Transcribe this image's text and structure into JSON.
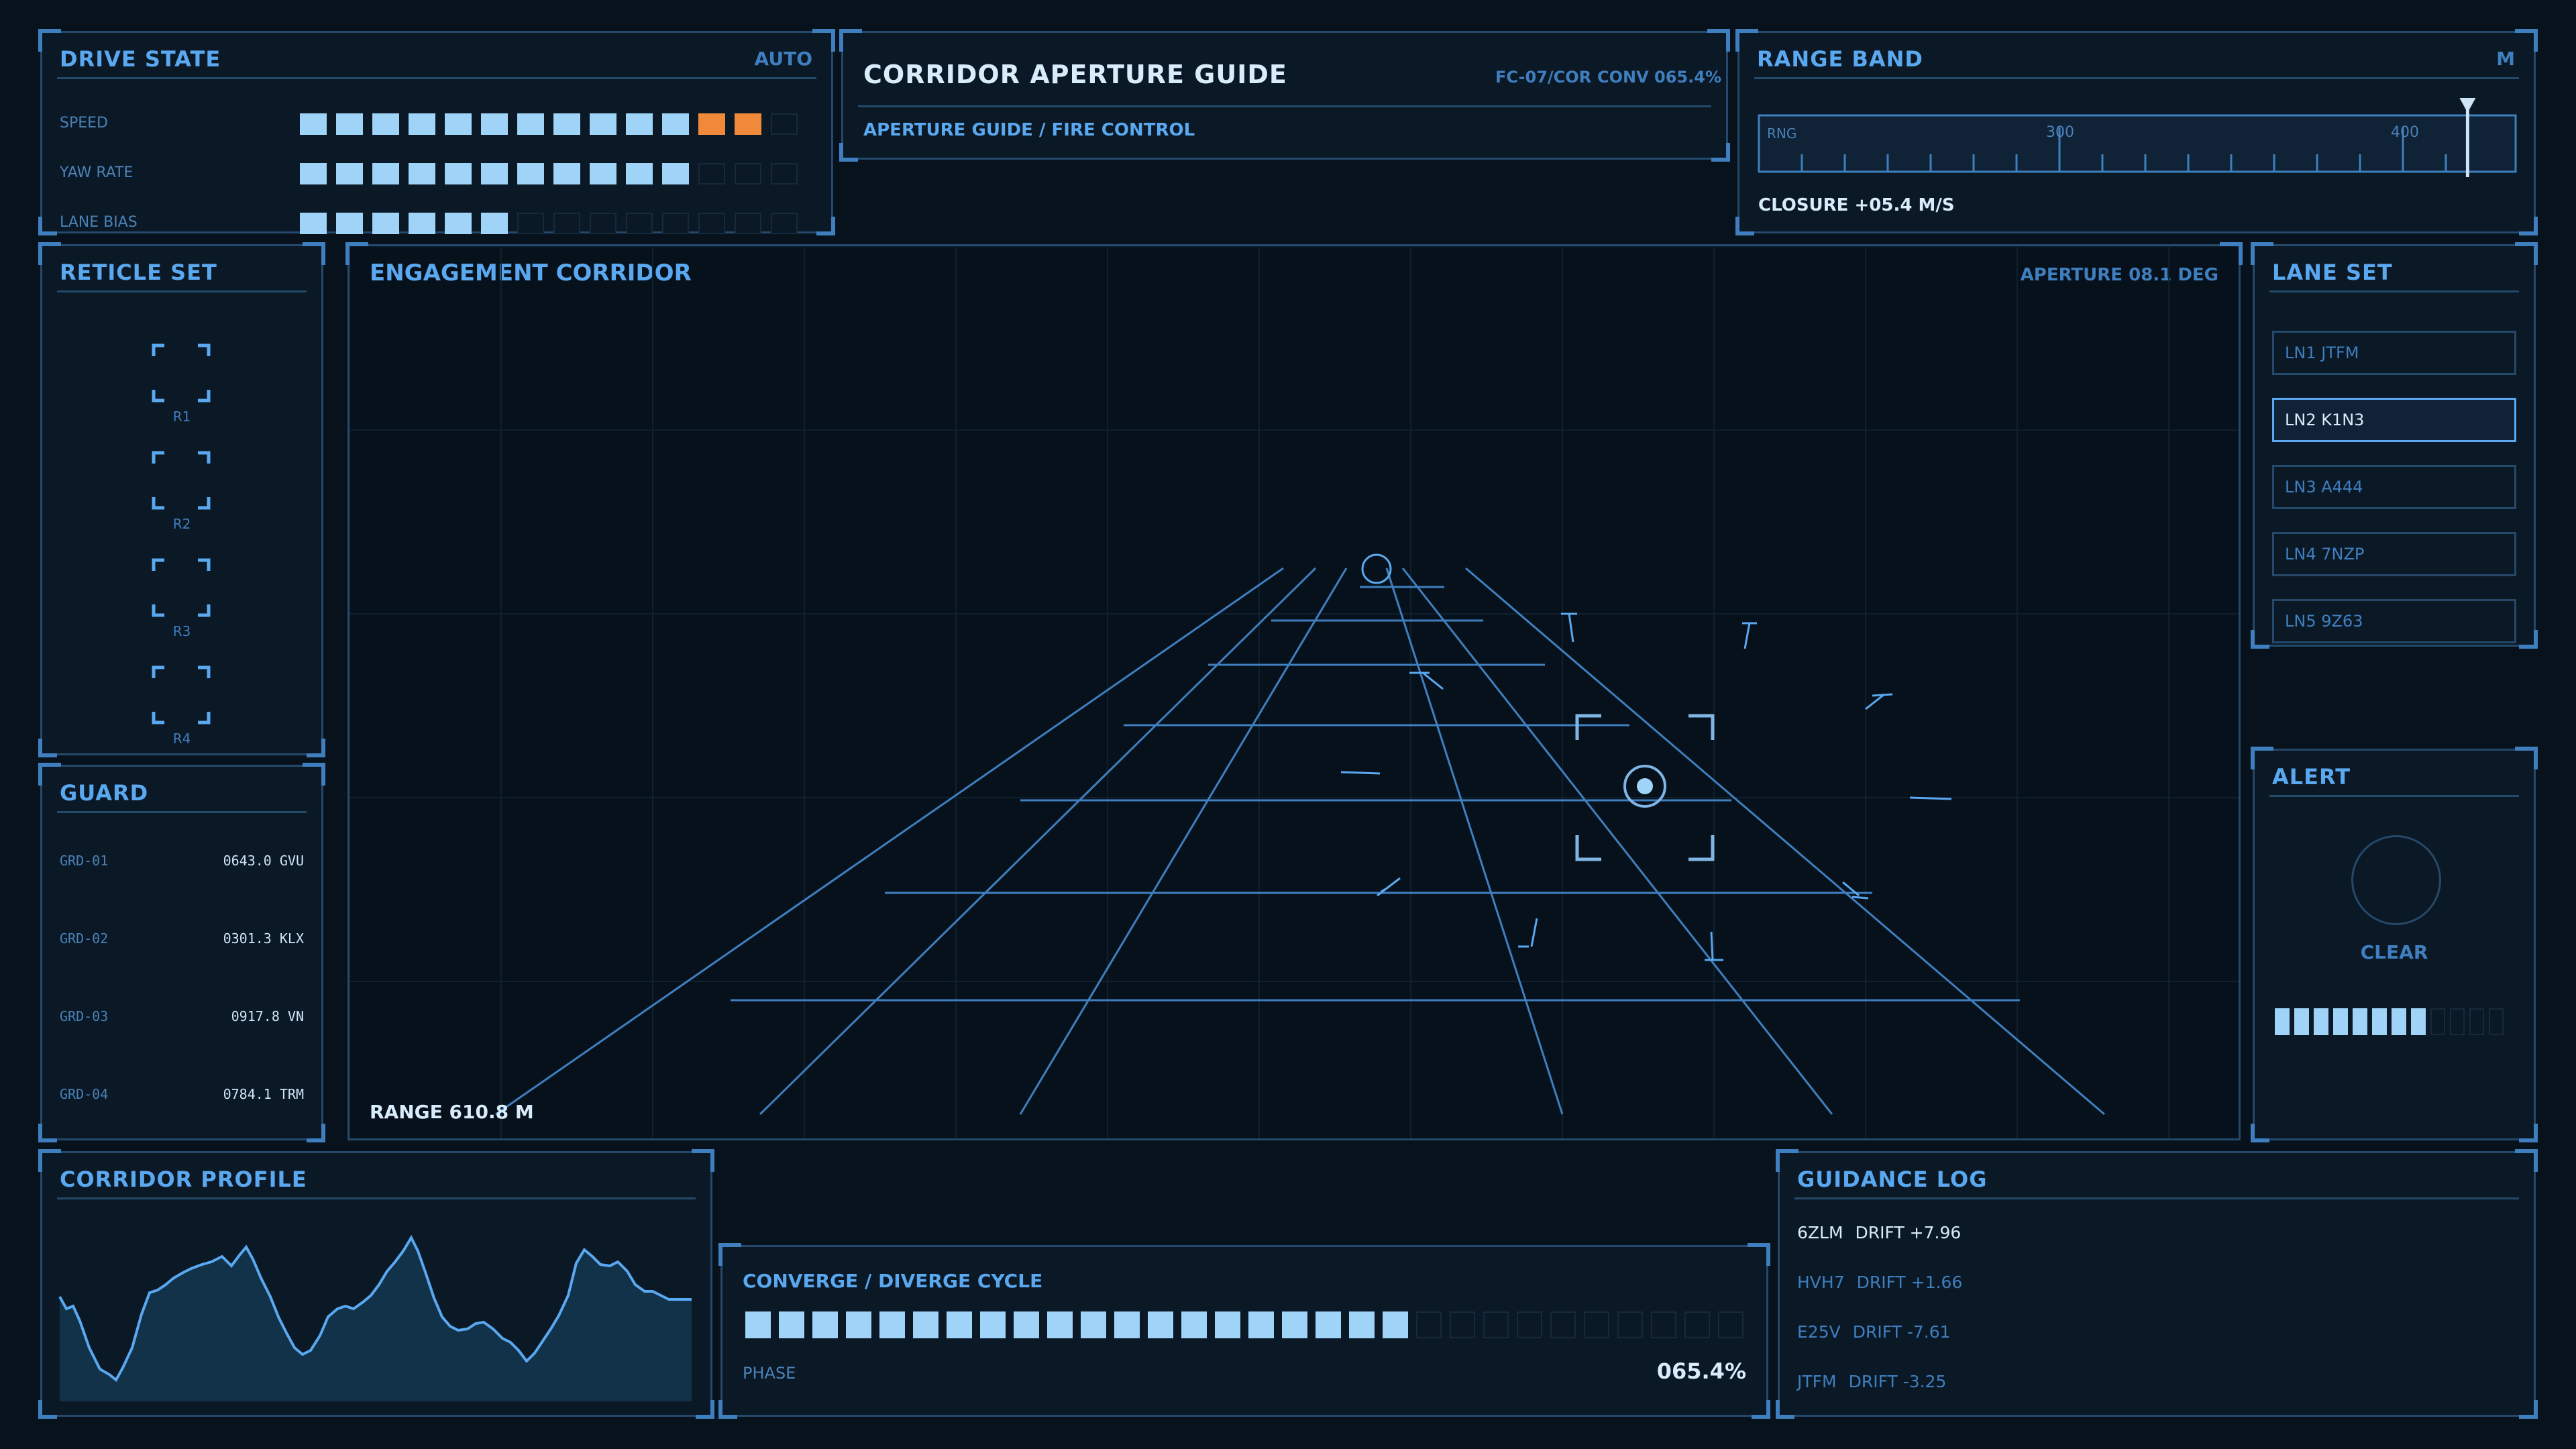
{
  "drive_state": {
    "title": "DRIVE STATE",
    "mode": "AUTO",
    "rows": [
      {
        "label": "SPEED",
        "segments": [
          "on",
          "on",
          "on",
          "on",
          "on",
          "on",
          "on",
          "on",
          "on",
          "on",
          "on",
          "warn",
          "warn",
          "off"
        ]
      },
      {
        "label": "YAW RATE",
        "segments": [
          "on",
          "on",
          "on",
          "on",
          "on",
          "on",
          "on",
          "on",
          "on",
          "on",
          "on",
          "off",
          "off",
          "off"
        ]
      },
      {
        "label": "LANE BIAS",
        "segments": [
          "on",
          "on",
          "on",
          "on",
          "on",
          "on",
          "off",
          "off",
          "off",
          "off",
          "off",
          "off",
          "off",
          "off"
        ]
      }
    ]
  },
  "header": {
    "title": "CORRIDOR APERTURE GUIDE",
    "code": "FC-07/COR",
    "conv": "CONV 065.4%",
    "subtitle": "APERTURE GUIDE / FIRE CONTROL"
  },
  "range_band": {
    "title": "RANGE BAND",
    "unit": "M",
    "scale_label": "RNG",
    "tick_300": "300",
    "tick_400": "400",
    "marker_value": 420,
    "closure": "CLOSURE +05.4 M/S"
  },
  "reticle_set": {
    "title": "RETICLE SET",
    "items": [
      "R1",
      "R2",
      "R3",
      "R4"
    ]
  },
  "guard": {
    "title": "GUARD",
    "rows": [
      {
        "key": "GRD-01",
        "value": "0643.0 GVU"
      },
      {
        "key": "GRD-02",
        "value": "0301.3 KLX"
      },
      {
        "key": "GRD-03",
        "value": "0917.8 VN"
      },
      {
        "key": "GRD-04",
        "value": "0784.1 TRM"
      }
    ]
  },
  "engagement": {
    "title": "ENGAGEMENT CORRIDOR",
    "aperture": "APERTURE 08.1 DEG",
    "range": "RANGE 610.8 M"
  },
  "lane_set": {
    "title": "LANE SET",
    "items": [
      "LN1 JTFM",
      "LN2 K1N3",
      "LN3 A444",
      "LN4 7NZP",
      "LN5 9Z63"
    ],
    "selected_index": 1
  },
  "alert": {
    "title": "ALERT",
    "status": "CLEAR",
    "level_filled": 8,
    "level_total": 12
  },
  "corridor_profile": {
    "title": "CORRIDOR PROFILE"
  },
  "cycle": {
    "title": "CONVERGE / DIVERGE CYCLE",
    "filled": 20,
    "total": 30,
    "phase_label": "PHASE",
    "phase_value": "065.4%"
  },
  "guidance_log": {
    "title": "GUIDANCE LOG",
    "entries": [
      {
        "id": "6ZLM",
        "text": "DRIFT +7.96",
        "active": true
      },
      {
        "id": "HVH7",
        "text": "DRIFT +1.66",
        "active": false
      },
      {
        "id": "E25V",
        "text": "DRIFT -7.61",
        "active": false
      },
      {
        "id": "JTFM",
        "text": "DRIFT -3.25",
        "active": false
      }
    ]
  },
  "colors": {
    "accent": "#5aa8f0",
    "segment_on": "#9fd3f7",
    "segment_warn": "#f08a3a",
    "border": "#25496b",
    "background": "#07121c"
  }
}
